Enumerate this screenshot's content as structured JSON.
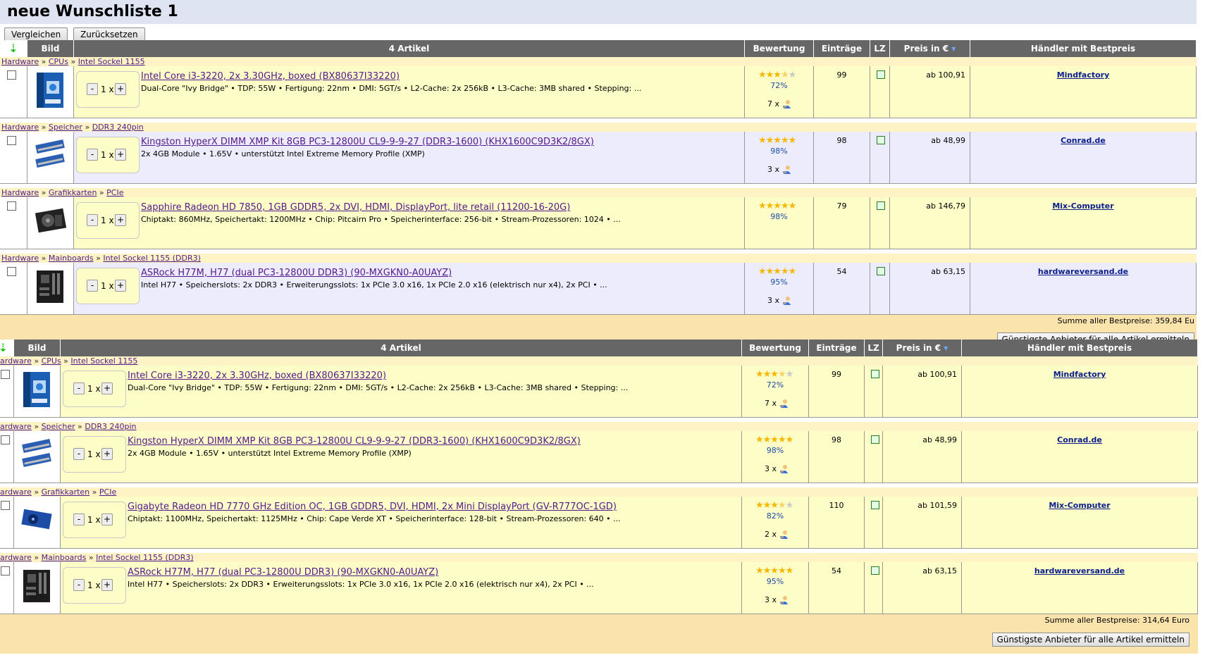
{
  "page_title": "neue Wunschliste 1",
  "buttons": {
    "compare": "Vergleichen",
    "reset": "Zurücksetzen"
  },
  "header": {
    "image": "Bild",
    "article_count": "4 Artikel",
    "rating": "Bewertung",
    "entries": "Einträge",
    "lz": "LZ",
    "price": "Preis in €",
    "dealer": "Händler mit Bestpreis"
  },
  "qty": {
    "minus": "-",
    "plus": "+",
    "value": "1 x"
  },
  "price_prefix": "ab",
  "lists": [
    {
      "items": [
        {
          "crumbs": [
            "Hardware",
            "CPUs",
            "Intel Sockel 1155"
          ],
          "name": "Intel Core i3-3220, 2x 3.30GHz, boxed (BX80637I33220)",
          "desc": "Dual-Core \"Ivy Bridge\" • TDP: 55W • Fertigung: 22nm • DMI: 5GT/s • L2-Cache: 2x 256kB • L3-Cache: 3MB shared • Stepping: ...",
          "stars": 3.5,
          "rating_pct": "72%",
          "reviews": "7 x",
          "entries": "99",
          "price": "ab 100,91",
          "dealer": "Mindfactory",
          "thumb": "cpu-box",
          "row_bg": "#fdfdc8"
        },
        {
          "crumbs": [
            "Hardware",
            "Speicher",
            "DDR3 240pin"
          ],
          "name": "Kingston HyperX DIMM XMP Kit 8GB PC3-12800U CL9-9-9-27 (DDR3-1600) (KHX1600C9D3K2/8GX)",
          "desc": "2x 4GB Module • 1.65V • unterstützt Intel Extreme Memory Profile (XMP)",
          "stars": 5,
          "rating_pct": "98%",
          "reviews": "3 x",
          "entries": "98",
          "price": "ab 48,99",
          "dealer": "Conrad.de",
          "thumb": "ram",
          "row_bg": "#ececfc"
        },
        {
          "crumbs": [
            "Hardware",
            "Grafikkarten",
            "PCIe"
          ],
          "name": "Sapphire Radeon HD 7850, 1GB GDDR5, 2x DVI, HDMI, DisplayPort, lite retail (11200-16-20G)",
          "desc": "Chiptakt: 860MHz, Speichertakt: 1200MHz • Chip: Pitcairn Pro • Speicherinterface: 256-bit • Stream-Prozessoren: 1024 • ...",
          "stars": 5,
          "rating_pct": "98%",
          "reviews": "",
          "entries": "79",
          "price": "ab 146,79",
          "dealer": "Mix-Computer",
          "thumb": "gpu",
          "row_bg": "#fdfdc8"
        },
        {
          "crumbs": [
            "Hardware",
            "Mainboards",
            "Intel Sockel 1155 (DDR3)"
          ],
          "name": "ASRock H77M, H77 (dual PC3-12800U DDR3) (90-MXGKN0-A0UAYZ)",
          "desc": "Intel H77 • Speicherslots: 2x DDR3 • Erweiterungsslots: 1x PCIe 3.0 x16, 1x PCIe 2.0 x16 (elektrisch nur x4), 2x PCI • ...",
          "stars": 5,
          "rating_pct": "95%",
          "reviews": "3 x",
          "entries": "54",
          "price": "ab 63,15",
          "dealer": "hardwareversand.de",
          "thumb": "board",
          "row_bg": "#ececfc"
        }
      ],
      "sum_text": "Summe aller Bestpreise: 359,84 Eu",
      "best_button": "Günstigste Anbieter für alle Artikel ermitteln"
    },
    {
      "items": [
        {
          "crumbs": [
            "Hardware",
            "CPUs",
            "Intel Sockel 1155"
          ],
          "crumb_first_visible": "ardware",
          "name": "Intel Core i3-3220, 2x 3.30GHz, boxed (BX80637I33220)",
          "desc": "Dual-Core \"Ivy Bridge\" • TDP: 55W • Fertigung: 22nm • DMI: 5GT/s • L2-Cache: 2x 256kB • L3-Cache: 3MB shared • Stepping: ...",
          "stars": 3.5,
          "rating_pct": "72%",
          "reviews": "7 x",
          "entries": "99",
          "price": "ab 100,91",
          "dealer": "Mindfactory",
          "thumb": "cpu-box",
          "row_bg": "#fdfdc8"
        },
        {
          "crumbs": [
            "Hardware",
            "Speicher",
            "DDR3 240pin"
          ],
          "crumb_first_visible": "ardware",
          "name": "Kingston HyperX DIMM XMP Kit 8GB PC3-12800U CL9-9-9-27 (DDR3-1600) (KHX1600C9D3K2/8GX)",
          "desc": "2x 4GB Module • 1.65V • unterstützt Intel Extreme Memory Profile (XMP)",
          "stars": 5,
          "rating_pct": "98%",
          "reviews": "3 x",
          "entries": "98",
          "price": "ab 48,99",
          "dealer": "Conrad.de",
          "thumb": "ram",
          "row_bg": "#fdfdc8"
        },
        {
          "crumbs": [
            "Hardware",
            "Grafikkarten",
            "PCIe"
          ],
          "crumb_first_visible": "ardware",
          "name": "Gigabyte Radeon HD 7770 GHz Edition OC, 1GB GDDR5, DVI, HDMI, 2x Mini DisplayPort (GV-R777OC-1GD)",
          "desc": "Chiptakt: 1100MHz, Speichertakt: 1125MHz • Chip: Cape Verde XT • Speicherinterface: 128-bit • Stream-Prozessoren: 640 • ...",
          "stars": 3.5,
          "rating_pct": "82%",
          "reviews": "2 x",
          "entries": "110",
          "price": "ab 101,59",
          "dealer": "Mix-Computer",
          "thumb": "gpu2",
          "row_bg": "#fdfdc8"
        },
        {
          "crumbs": [
            "Hardware",
            "Mainboards",
            "Intel Sockel 1155 (DDR3)"
          ],
          "crumb_first_visible": "ardware",
          "name": "ASRock H77M, H77 (dual PC3-12800U DDR3) (90-MXGKN0-A0UAYZ)",
          "desc": "Intel H77 • Speicherslots: 2x DDR3 • Erweiterungsslots: 1x PCIe 3.0 x16, 1x PCIe 2.0 x16 (elektrisch nur x4), 2x PCI • ...",
          "stars": 5,
          "rating_pct": "95%",
          "reviews": "3 x",
          "entries": "54",
          "price": "ab 63,15",
          "dealer": "hardwareversand.de",
          "thumb": "board",
          "row_bg": "#fdfdc8"
        }
      ],
      "sum_text": "Summe aller Bestpreise: 314,64 Euro",
      "best_button": "Günstigste Anbieter für alle Artikel ermitteln"
    }
  ]
}
